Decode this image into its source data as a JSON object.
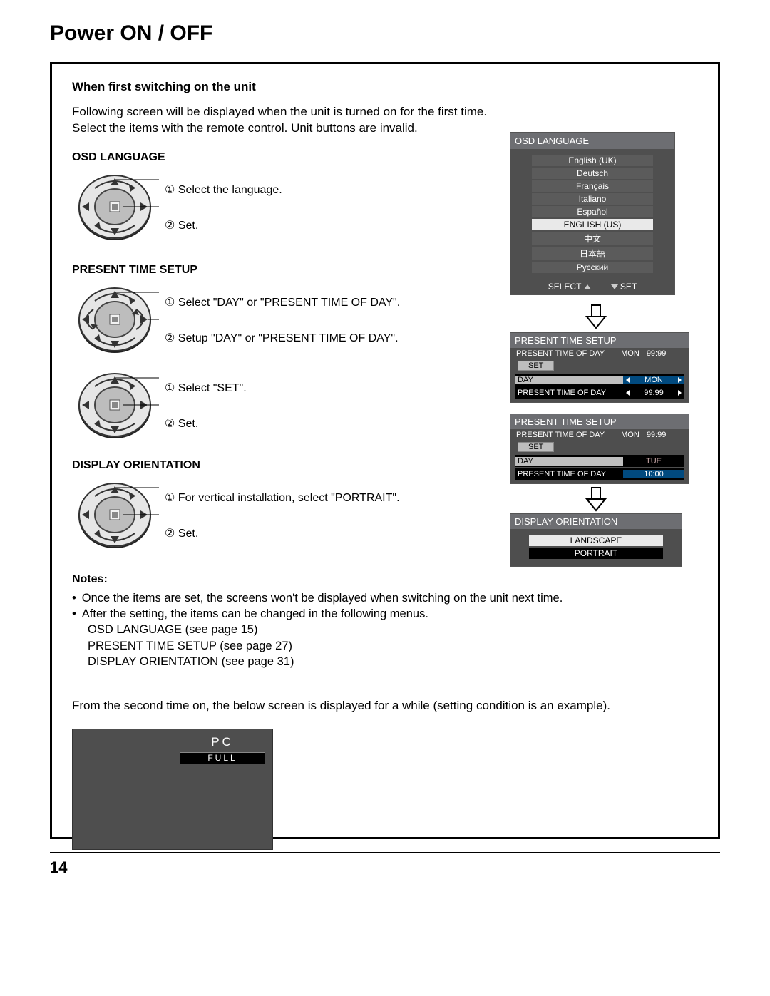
{
  "page_title": "Power ON / OFF",
  "page_number": "14",
  "intro_heading": "When first switching on the unit",
  "intro_para1": "Following screen will be displayed when the unit is turned on for the first time.",
  "intro_para2": "Select the items with the remote control. Unit buttons are invalid.",
  "osd": {
    "heading": "OSD LANGUAGE",
    "step1_num": "1",
    "step1": "Select the language.",
    "step2_num": "2",
    "step2": "Set.",
    "panel_title": "OSD LANGUAGE",
    "items": [
      "English (UK)",
      "Deutsch",
      "Français",
      "Italiano",
      "Español",
      "ENGLISH (US)",
      "中文",
      "日本語",
      "Русский"
    ],
    "selected_index": 5,
    "footer_select": "SELECT",
    "footer_set": "SET"
  },
  "pts": {
    "heading": "PRESENT TIME SETUP",
    "a_step1_num": "1",
    "a_step1": "Select \"DAY\" or \"PRESENT TIME OF DAY\".",
    "a_step2_num": "2",
    "a_step2": "Setup \"DAY\" or \"PRESENT TIME OF DAY\".",
    "b_step1_num": "1",
    "b_step1": "Select \"SET\".",
    "b_step2_num": "2",
    "b_step2": "Set.",
    "panel_title": "PRESENT TIME SETUP",
    "readout_label": "PRESENT TIME OF DAY",
    "readout_day": "MON",
    "readout_time": "99:99",
    "set_label": "SET",
    "row_day_label": "DAY",
    "row_time_label": "PRESENT TIME OF DAY",
    "panel1": {
      "day": "MON",
      "time": "99:99",
      "selected": "day"
    },
    "panel2": {
      "day": "TUE",
      "time": "10:00",
      "selected": "time"
    }
  },
  "do": {
    "heading": "DISPLAY ORIENTATION",
    "step1_num": "1",
    "step1": "For vertical installation, select \"PORTRAIT\".",
    "step2_num": "2",
    "step2": "Set.",
    "panel_title": "DISPLAY ORIENTATION",
    "items": [
      "LANDSCAPE",
      "PORTRAIT"
    ],
    "selected_index": 0
  },
  "notes": {
    "heading": "Notes:",
    "n1": "Once the items are set, the screens won't be displayed when switching on the unit next time.",
    "n2": "After the setting, the items can be changed in the following menus.",
    "n2a": "OSD LANGUAGE (see page 15)",
    "n2b": "PRESENT TIME SETUP (see page 27)",
    "n2c": "DISPLAY ORIENTATION (see page 31)"
  },
  "second_para": "From the second time on, the below screen is displayed for a while (setting condition is an example).",
  "splash": {
    "pc": "PC",
    "full": "FULL"
  }
}
